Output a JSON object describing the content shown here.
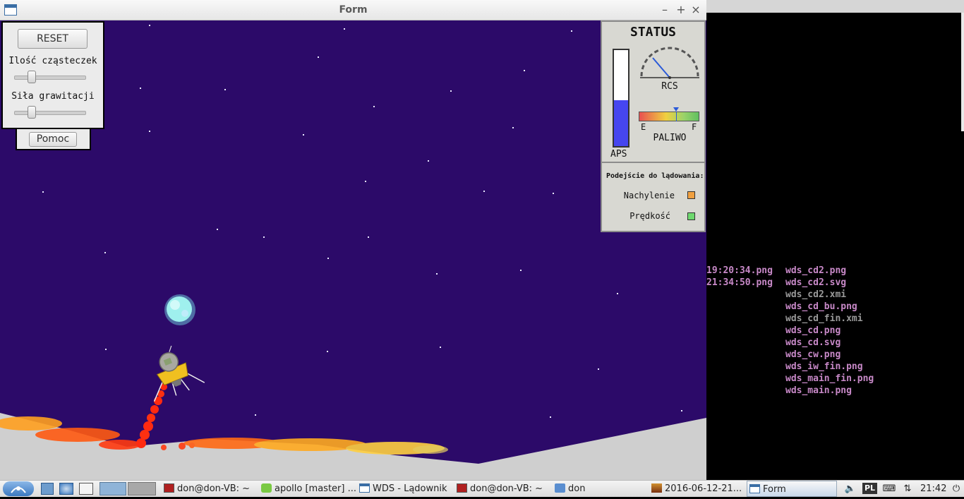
{
  "window": {
    "title": "Form",
    "controls": {
      "minimize": "–",
      "maximize": "+",
      "close": "×"
    }
  },
  "controls_panel": {
    "reset_label": "RESET",
    "particles_label": "Ilość cząsteczek",
    "particles_level": 0.25,
    "gravity_label": "Siła grawitacji",
    "gravity_level": 0.25,
    "help_label": "Pomoc"
  },
  "status_panel": {
    "title": "STATUS",
    "aps_label": "APS",
    "aps_level": 0.48,
    "rcs_label": "RCS",
    "fuel_label": "PALIWO",
    "fuel_empty": "E",
    "fuel_full": "F",
    "fuel_level": 0.62,
    "landing_title": "Podejście do lądowania:",
    "tilt_label": "Nachylenie",
    "tilt_color": "#f0a040",
    "speed_label": "Prędkość",
    "speed_color": "#6ed86e"
  },
  "terminal": {
    "lines": [
      {
        "time": "19:20:34.png",
        "file": "wds_cd2.png",
        "color": "#c889c8"
      },
      {
        "time": "21:34:50.png",
        "file": "wds_cd2.svg",
        "color": "#c889c8"
      },
      {
        "time": "",
        "file": "wds_cd2.xmi",
        "color": "#9a9a9a"
      },
      {
        "time": "",
        "file": "wds_cd_bu.png",
        "color": "#c889c8"
      },
      {
        "time": "",
        "file": "wds_cd_fin.xmi",
        "color": "#9a9a9a"
      },
      {
        "time": "",
        "file": "wds_cd.png",
        "color": "#c889c8"
      },
      {
        "time": "",
        "file": "wds_cd.svg",
        "color": "#c889c8"
      },
      {
        "time": "",
        "file": "wds_cw.png",
        "color": "#c889c8"
      },
      {
        "time": "",
        "file": "wds_iw_fin.png",
        "color": "#c889c8"
      },
      {
        "time": "",
        "file": "wds_main_fin.png",
        "color": "#c889c8"
      },
      {
        "time": "",
        "file": "wds_main.png",
        "color": "#c889c8"
      }
    ]
  },
  "taskbar": {
    "tasks": [
      {
        "label": "don@don-VB: ~",
        "icon": "terminal-icon"
      },
      {
        "label": "apollo [master] ...",
        "icon": "qt-creator-icon"
      },
      {
        "label": "WDS - Lądownik",
        "icon": "window-icon"
      },
      {
        "label": "don@don-VB: ~",
        "icon": "terminal-icon"
      },
      {
        "label": "don",
        "icon": "folder-icon"
      },
      {
        "label": "2016-06-12-21...",
        "icon": "image-icon"
      },
      {
        "label": "Form",
        "icon": "window-icon"
      }
    ],
    "keyboard_layout": "PL",
    "clock": "21:42"
  },
  "colors": {
    "sky": "#2c0a69",
    "ground": "#cfcfcf",
    "earth": "#9ff0ee",
    "flame": "#ff3a10"
  }
}
